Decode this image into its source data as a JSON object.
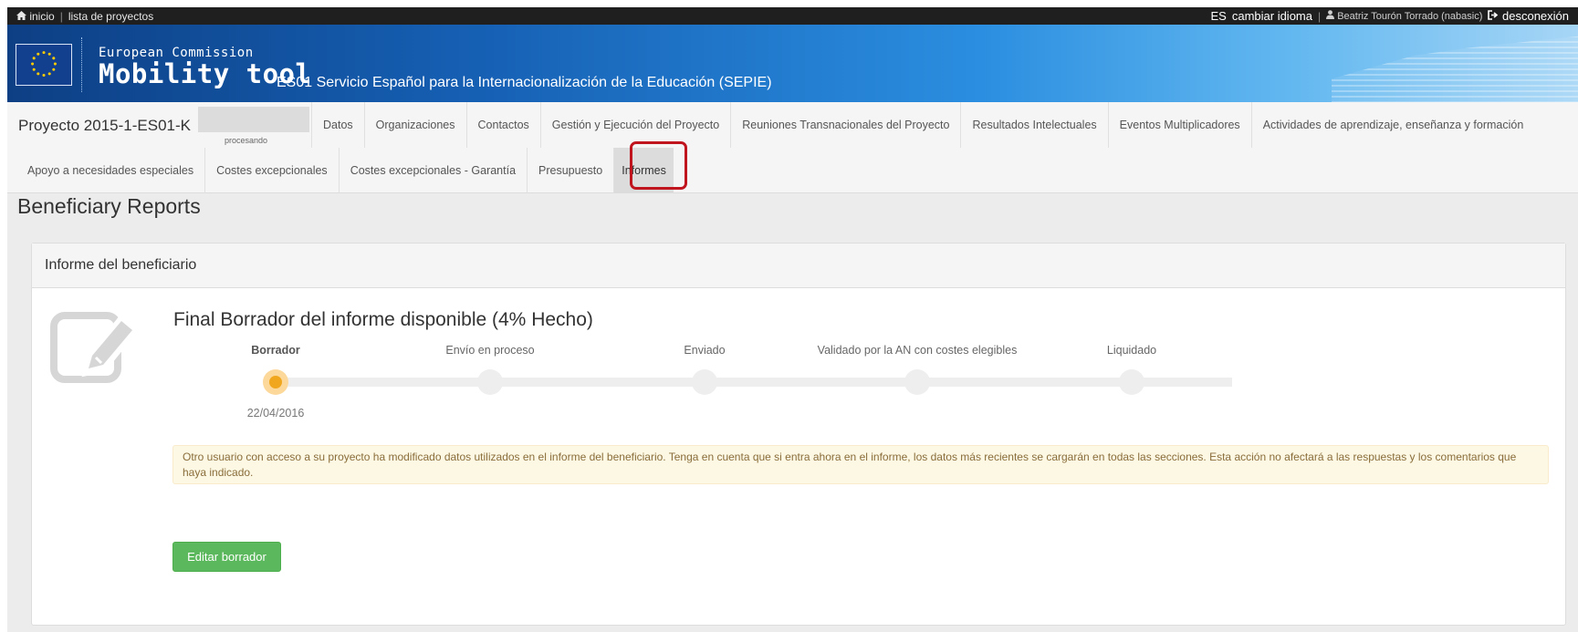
{
  "topbar": {
    "home": "inicio",
    "projects": "lista de proyectos",
    "language_code": "ES",
    "change_language": "cambiar idioma",
    "user": "Beatriz Tourón Torrado (nabasic)",
    "logout": "desconexión"
  },
  "banner": {
    "brand_small": "European Commission",
    "brand_large": "Mobility tool",
    "service": "ES01 Servicio Español para la Internacionalización de la Educación (SEPIE)"
  },
  "nav": {
    "project_title": "Proyecto 2015-1-ES01-K",
    "processing": "procesando",
    "tabs_row1": [
      "Datos",
      "Organizaciones",
      "Contactos",
      "Gestión y Ejecución del Proyecto",
      "Reuniones Transnacionales del Proyecto",
      "Resultados Intelectuales",
      "Eventos Multiplicadores",
      "Actividades de aprendizaje, enseñanza y formación"
    ],
    "tabs_row2": [
      "Apoyo a necesidades especiales",
      "Costes excepcionales",
      "Costes excepcionales - Garantía",
      "Presupuesto",
      "Informes"
    ],
    "active_tab": "Informes"
  },
  "page": {
    "title": "Beneficiary Reports",
    "panel_heading": "Informe del beneficiario",
    "report_title": "Final Borrador del informe disponible (4% Hecho)",
    "progress_percent": 4,
    "steps": [
      "Borrador",
      "Envío en proceso",
      "Enviado",
      "Validado por la AN con costes elegibles",
      "Liquidado"
    ],
    "current_step_index": 0,
    "current_step_date": "22/04/2016",
    "alert": "Otro usuario con acceso a su proyecto ha modificado datos utilizados en el informe del beneficiario. Tenga en cuenta que si entra ahora en el informe, los datos más recientes se cargarán en todas las secciones. Esta acción no afectará a las respuestas y los comentarios que haya indicado.",
    "edit_button": "Editar borrador"
  },
  "colors": {
    "banner_blue": "#1660b4",
    "highlight_red": "#c0141f",
    "current_step": "#f0a71e",
    "button_green": "#5cb85c",
    "alert_bg": "#fcf8e3"
  },
  "icons": [
    "home-icon",
    "user-icon",
    "logout-icon",
    "eu-flag-logo",
    "edit-document-icon"
  ]
}
